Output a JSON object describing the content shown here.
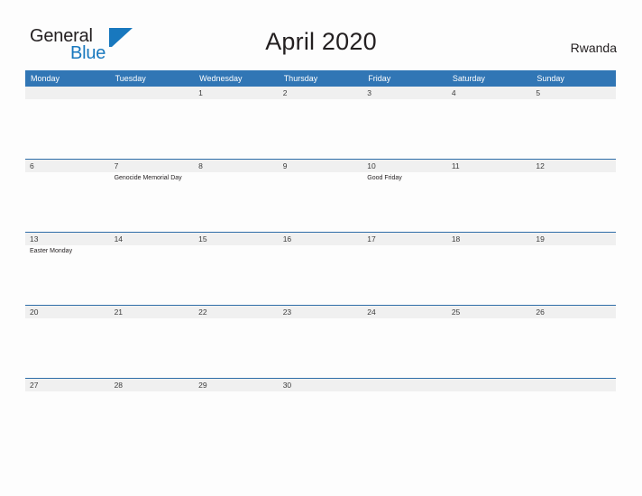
{
  "brand": {
    "word_one": "General",
    "word_two": "Blue",
    "mark": "blue-triangle-flag"
  },
  "header": {
    "title": "April 2020",
    "region": "Rwanda"
  },
  "colors": {
    "header_blue": "#3176b5",
    "rule_blue": "#2e6da8",
    "date_band_gray": "#f0f0f0",
    "brand_blue": "#1878be",
    "page_background": "#fdfdfd",
    "text_dark": "#231f20"
  },
  "calendar": {
    "weekdays": [
      "Monday",
      "Tuesday",
      "Wednesday",
      "Thursday",
      "Friday",
      "Saturday",
      "Sunday"
    ],
    "weeks": [
      [
        {
          "day": "",
          "events": []
        },
        {
          "day": "",
          "events": []
        },
        {
          "day": "1",
          "events": []
        },
        {
          "day": "2",
          "events": []
        },
        {
          "day": "3",
          "events": []
        },
        {
          "day": "4",
          "events": []
        },
        {
          "day": "5",
          "events": []
        }
      ],
      [
        {
          "day": "6",
          "events": []
        },
        {
          "day": "7",
          "events": [
            "Genocide Memorial Day"
          ]
        },
        {
          "day": "8",
          "events": []
        },
        {
          "day": "9",
          "events": []
        },
        {
          "day": "10",
          "events": [
            "Good Friday"
          ]
        },
        {
          "day": "11",
          "events": []
        },
        {
          "day": "12",
          "events": []
        }
      ],
      [
        {
          "day": "13",
          "events": [
            "Easter Monday"
          ]
        },
        {
          "day": "14",
          "events": []
        },
        {
          "day": "15",
          "events": []
        },
        {
          "day": "16",
          "events": []
        },
        {
          "day": "17",
          "events": []
        },
        {
          "day": "18",
          "events": []
        },
        {
          "day": "19",
          "events": []
        }
      ],
      [
        {
          "day": "20",
          "events": []
        },
        {
          "day": "21",
          "events": []
        },
        {
          "day": "22",
          "events": []
        },
        {
          "day": "23",
          "events": []
        },
        {
          "day": "24",
          "events": []
        },
        {
          "day": "25",
          "events": []
        },
        {
          "day": "26",
          "events": []
        }
      ],
      [
        {
          "day": "27",
          "events": []
        },
        {
          "day": "28",
          "events": []
        },
        {
          "day": "29",
          "events": []
        },
        {
          "day": "30",
          "events": []
        },
        {
          "day": "",
          "events": []
        },
        {
          "day": "",
          "events": []
        },
        {
          "day": "",
          "events": []
        }
      ]
    ]
  }
}
